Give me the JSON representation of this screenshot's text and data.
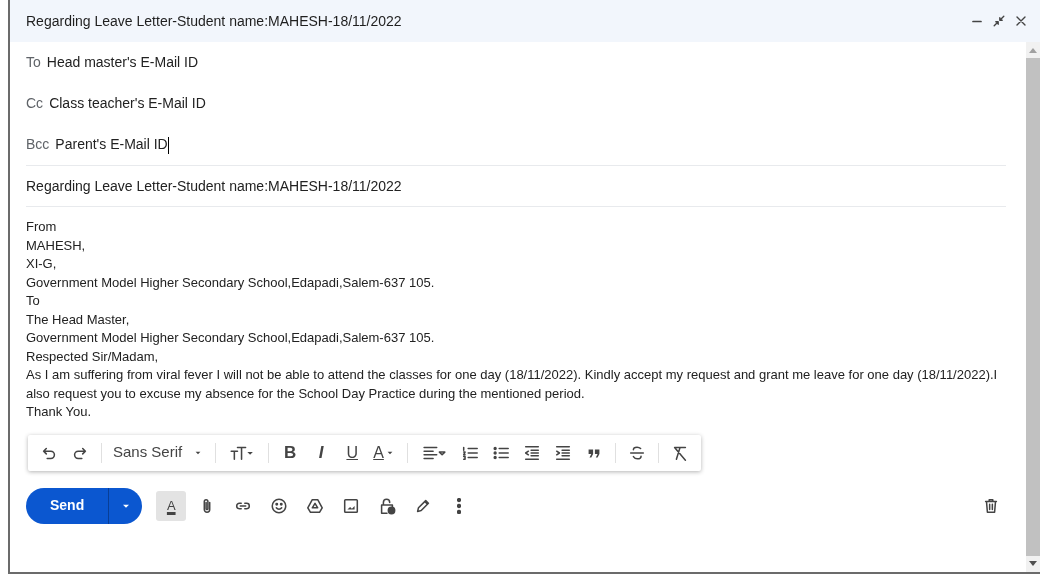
{
  "window": {
    "title": "Regarding Leave Letter-Student name:MAHESH-18/11/2022"
  },
  "recipients": [
    {
      "label": "To",
      "value": "Head master's E-Mail ID",
      "focused": false
    },
    {
      "label": "Cc",
      "value": "Class teacher's E-Mail ID",
      "focused": false
    },
    {
      "label": "Bcc",
      "value": "Parent's E-Mail ID",
      "focused": true
    }
  ],
  "subject": "Regarding Leave Letter-Student name:MAHESH-18/11/2022",
  "body": [
    "From",
    "MAHESH,",
    "XI-G,",
    "Government Model Higher Secondary School,Edapadi,Salem-637 105.",
    "To",
    "The Head Master,",
    "Government Model Higher Secondary School,Edapadi,Salem-637 105.",
    "Respected Sir/Madam,",
    "As I am suffering from viral fever I will not be able to attend the classes for one day (18/11/2022). Kindly accept my request and grant me leave for one day (18/11/2022).I also request you to excuse my absence for the School Day Practice during the mentioned period.",
    "Thank You."
  ],
  "format_toolbar": {
    "font": "Sans Serif",
    "bold": "B",
    "italic": "I",
    "underline": "U",
    "text_color": "A"
  },
  "bottom_bar": {
    "send": "Send",
    "format_toggle": {
      "label": "A",
      "selected": true
    }
  }
}
